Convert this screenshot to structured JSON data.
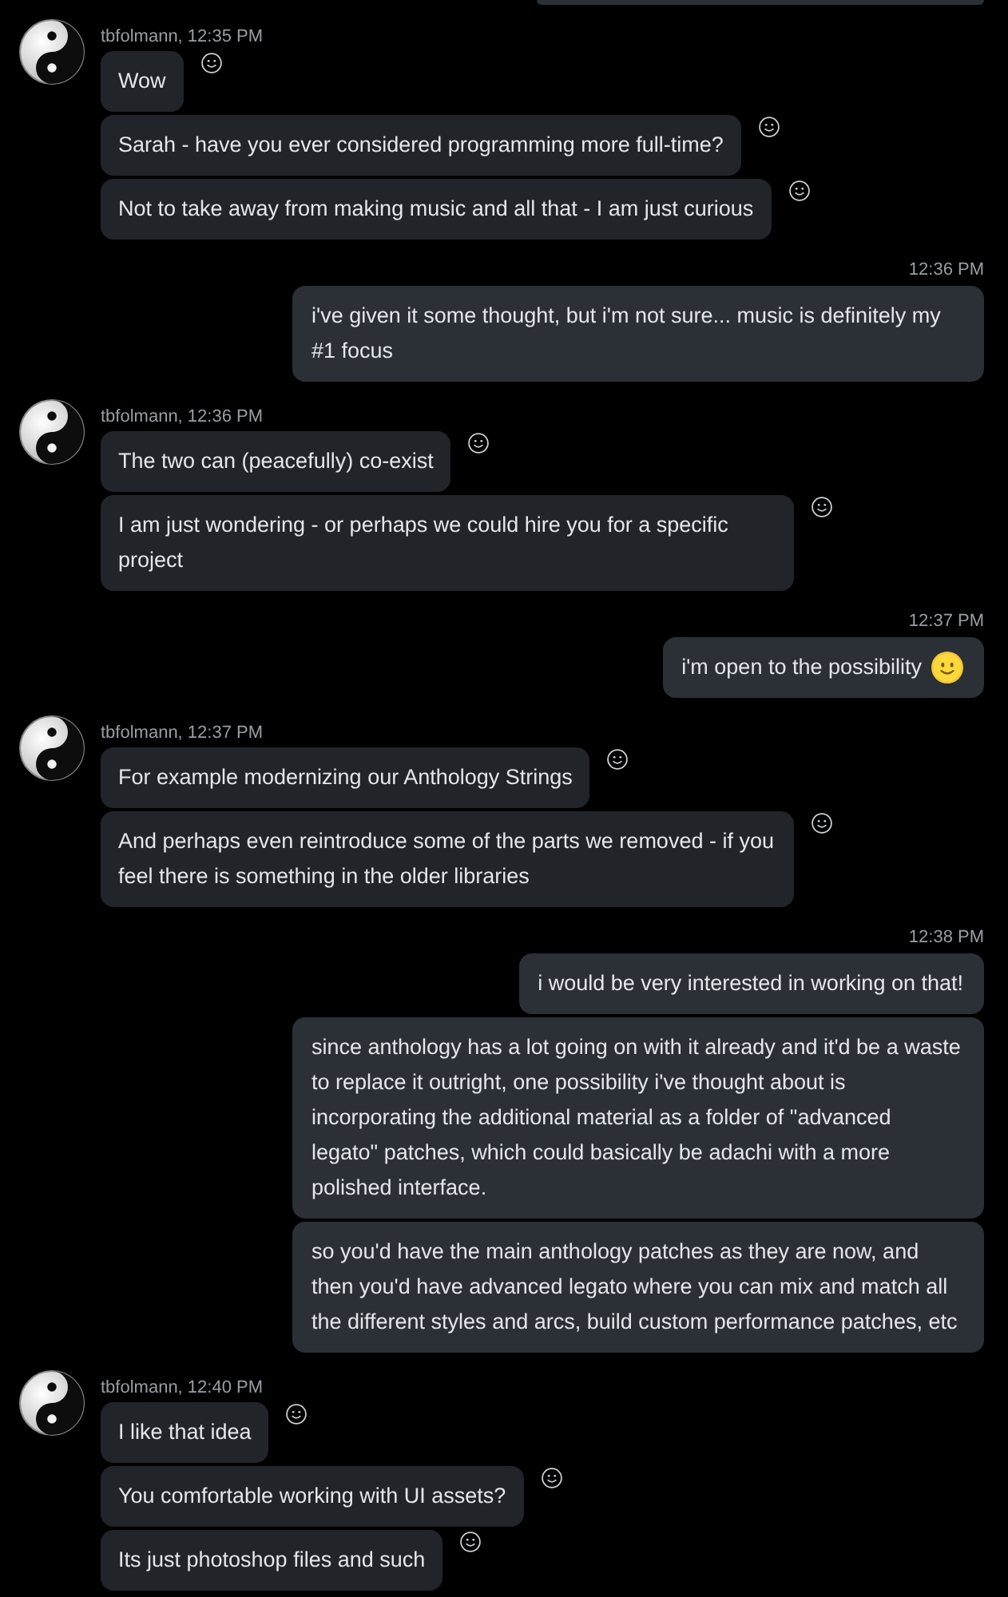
{
  "messages": [
    {
      "kind": "outgoing_partial"
    },
    {
      "kind": "incoming",
      "header": "tbfolmann, 12:35 PM",
      "bubbles": [
        {
          "kind": "text",
          "text": "Wow"
        },
        {
          "kind": "text",
          "text": "Sarah - have you ever considered programming more full-time?"
        },
        {
          "kind": "text",
          "text": "Not to take away from making music and all that - I am just curious"
        }
      ]
    },
    {
      "kind": "outgoing",
      "time": "12:36 PM",
      "bubbles": [
        {
          "kind": "text",
          "text": "i've given it some thought, but i'm not sure... music is definitely my #1 focus"
        }
      ]
    },
    {
      "kind": "incoming",
      "header": "tbfolmann, 12:36 PM",
      "bubbles": [
        {
          "kind": "text",
          "text": "The two can (peacefully) co-exist"
        },
        {
          "kind": "text",
          "text": "I am just wondering - or perhaps we could hire you for a specific project"
        }
      ]
    },
    {
      "kind": "outgoing",
      "time": "12:37 PM",
      "bubbles": [
        {
          "kind": "smiley",
          "text": "i'm open to the possibility"
        }
      ]
    },
    {
      "kind": "incoming",
      "header": "tbfolmann, 12:37 PM",
      "bubbles": [
        {
          "kind": "text",
          "text": "For example modernizing our Anthology Strings"
        },
        {
          "kind": "text",
          "text": "And perhaps even reintroduce some of the parts we removed - if you feel there is something in the older libraries"
        }
      ]
    },
    {
      "kind": "outgoing",
      "time": "12:38 PM",
      "bubbles": [
        {
          "kind": "text",
          "text": "i would be very interested in working on that!"
        },
        {
          "kind": "text",
          "text": "since anthology has a lot going on with it already and it'd be a waste to replace it outright, one possibility i've thought about is incorporating the additional material as a folder of \"advanced legato\" patches, which could basically be adachi with a more polished interface."
        },
        {
          "kind": "text",
          "text": "so you'd have the main anthology patches as they are now, and then you'd have advanced legato where you can mix and match all the different styles and arcs, build custom performance patches, etc"
        }
      ]
    },
    {
      "kind": "incoming",
      "header": "tbfolmann, 12:40 PM",
      "bubbles": [
        {
          "kind": "text",
          "text": "I like that idea"
        },
        {
          "kind": "text",
          "text": "You comfortable working with UI assets?"
        },
        {
          "kind": "text",
          "text": "Its just photoshop files and such"
        }
      ]
    }
  ]
}
